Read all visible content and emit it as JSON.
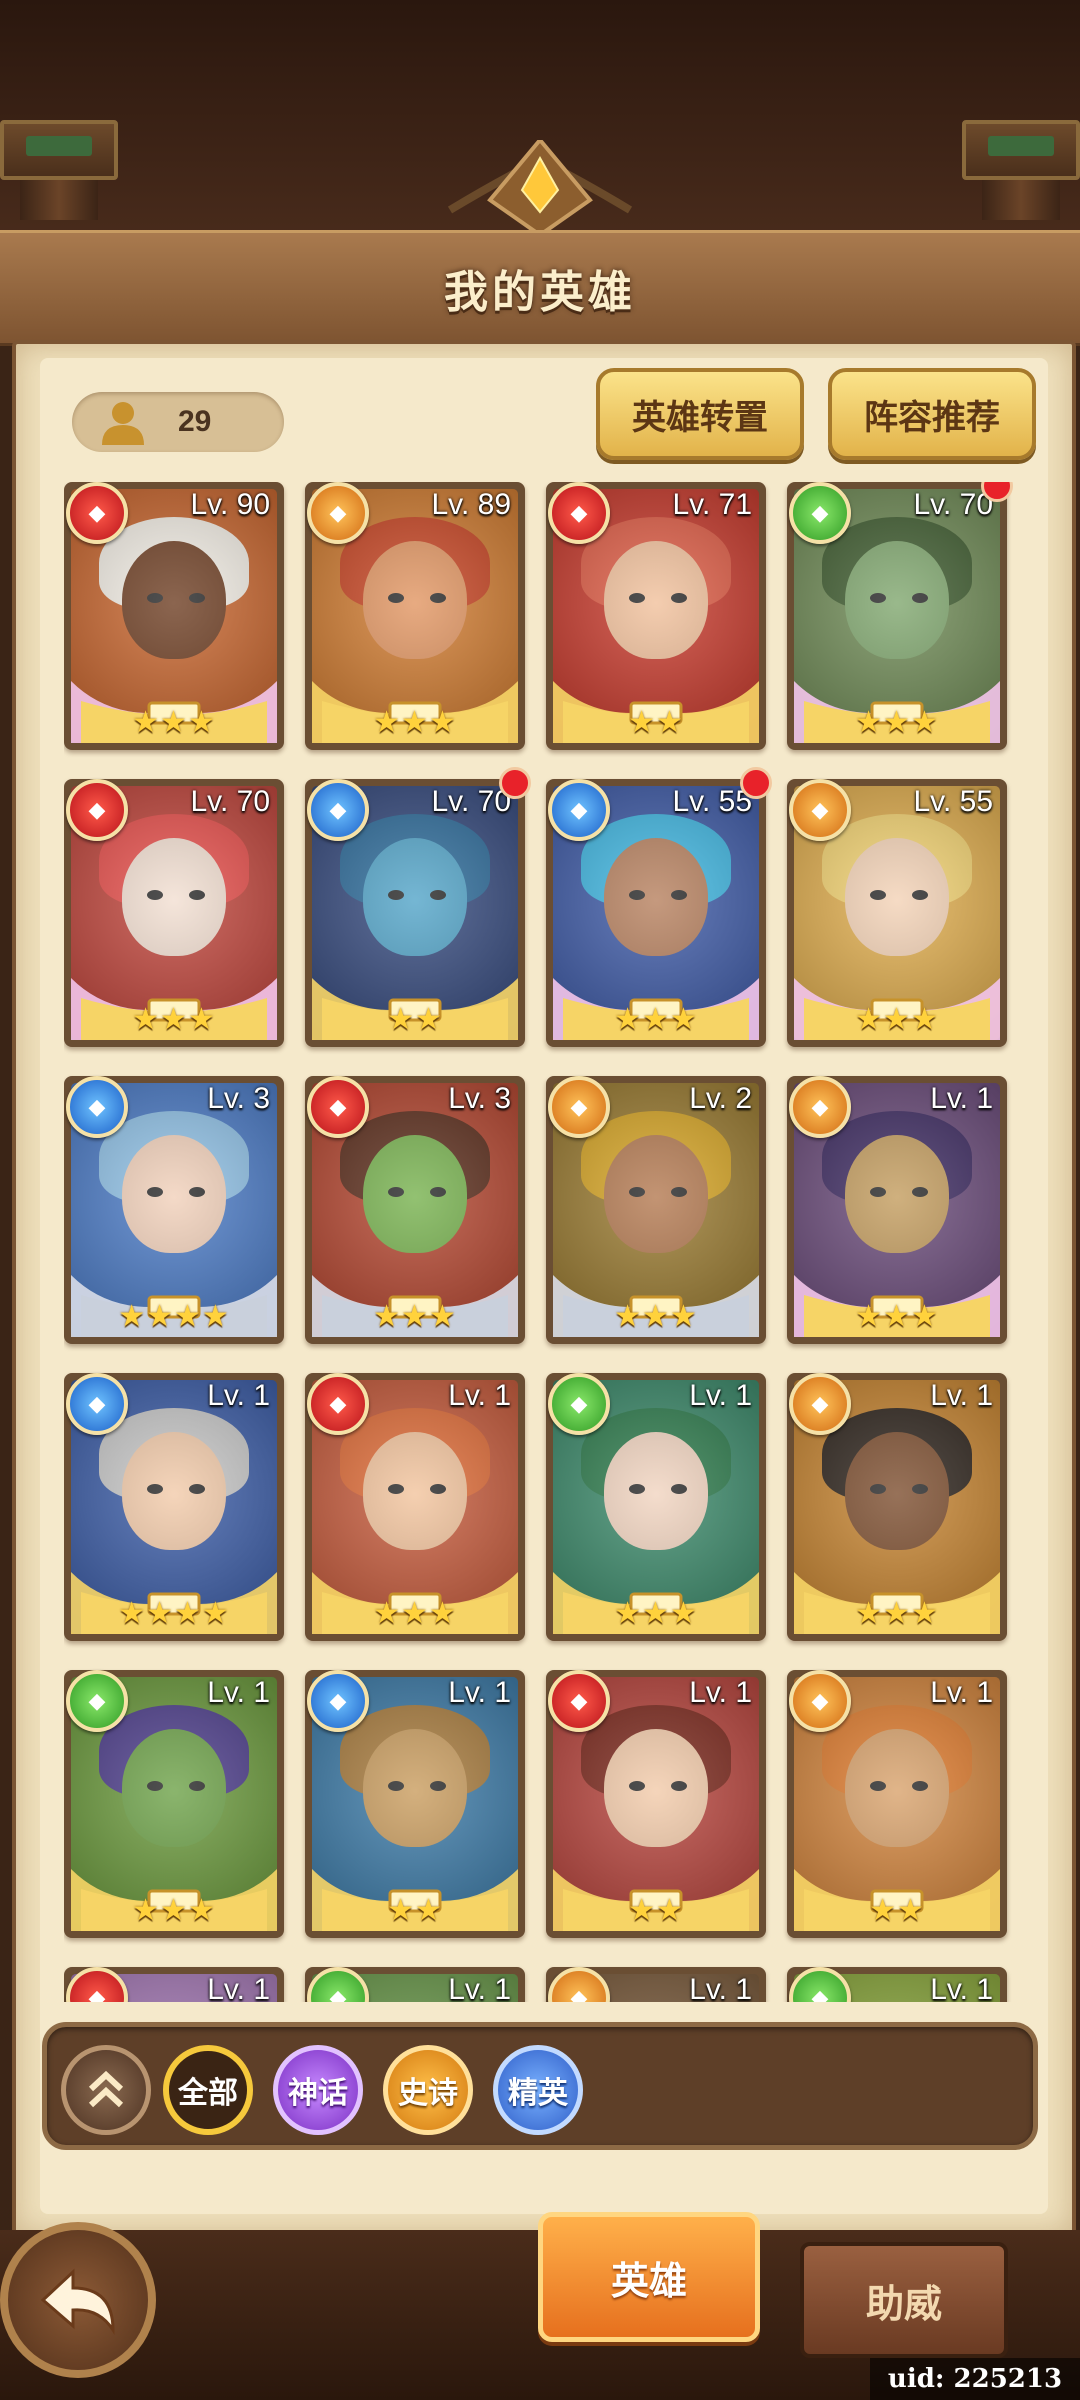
{
  "header": {
    "title": "我的英雄"
  },
  "count": {
    "value": "29"
  },
  "buttons": {
    "transfer": "英雄转置",
    "lineup": "阵容推荐"
  },
  "heroes": [
    {
      "level": "Lv. 90",
      "element": "fire",
      "stars": "★★★",
      "rarity": "mythic",
      "notify": false,
      "bg": "#c9642b",
      "skin": "#6b3a1e",
      "hair": "#f4efe6"
    },
    {
      "level": "Lv. 89",
      "element": "earth",
      "stars": "★★★",
      "rarity": "epic",
      "notify": false,
      "bg": "#d27b2e",
      "skin": "#e1935e",
      "hair": "#c8421f"
    },
    {
      "level": "Lv. 71",
      "element": "fire",
      "stars": "★★",
      "rarity": "epic",
      "notify": false,
      "bg": "#c9382a",
      "skin": "#f1bf99",
      "hair": "#e05a42"
    },
    {
      "level": "Lv. 70",
      "element": "nature",
      "stars": "★★★",
      "rarity": "mythic",
      "notify": true,
      "bg": "#6f8b55",
      "skin": "#7da56b",
      "hair": "#3c5a2c"
    },
    {
      "level": "Lv. 70",
      "element": "fire",
      "stars": "★★★",
      "rarity": "mythic",
      "notify": false,
      "bg": "#c2443a",
      "skin": "#f2ded0",
      "hair": "#e94c48"
    },
    {
      "level": "Lv. 70",
      "element": "water",
      "stars": "★★",
      "rarity": "epic",
      "notify": true,
      "bg": "#34497e",
      "skin": "#4ea2c7",
      "hair": "#2a6a9a"
    },
    {
      "level": "Lv. 55",
      "element": "water",
      "stars": "★★★",
      "rarity": "mythic",
      "notify": true,
      "bg": "#3d5aa8",
      "skin": "#b57d5a",
      "hair": "#3cb6e2"
    },
    {
      "level": "Lv. 55",
      "element": "earth",
      "stars": "★★★",
      "rarity": "mythic",
      "notify": false,
      "bg": "#e2ae4c",
      "skin": "#f3d1b4",
      "hair": "#f4d36f"
    },
    {
      "level": "Lv. 3",
      "element": "water",
      "stars": "★★★★",
      "rarity": "elite",
      "notify": false,
      "bg": "#4a7bc8",
      "skin": "#f1cfb8",
      "hair": "#8fc2e8"
    },
    {
      "level": "Lv. 3",
      "element": "fire",
      "stars": "★★★",
      "rarity": "elite",
      "notify": false,
      "bg": "#b6452e",
      "skin": "#74b04a",
      "hair": "#5a2a18"
    },
    {
      "level": "Lv. 2",
      "element": "earth",
      "stars": "★★★",
      "rarity": "elite",
      "notify": false,
      "bg": "#9a7a2e",
      "skin": "#b2764c",
      "hair": "#d7a420"
    },
    {
      "level": "Lv. 1",
      "element": "earth",
      "stars": "★★★",
      "rarity": "mythic",
      "notify": false,
      "bg": "#6a4a7a",
      "skin": "#c29a5a",
      "hair": "#3b2860"
    },
    {
      "level": "Lv. 1",
      "element": "water",
      "stars": "★★★★",
      "rarity": "epic",
      "notify": false,
      "bg": "#3a5ca8",
      "skin": "#f2c9a7",
      "hair": "#c8c8c8"
    },
    {
      "level": "Lv. 1",
      "element": "fire",
      "stars": "★★★",
      "rarity": "epic",
      "notify": false,
      "bg": "#c85a3a",
      "skin": "#f2c29a",
      "hair": "#e16a34"
    },
    {
      "level": "Lv. 1",
      "element": "nature",
      "stars": "★★★",
      "rarity": "epic",
      "notify": false,
      "bg": "#3a8a6a",
      "skin": "#f1d3be",
      "hair": "#2a7a4a"
    },
    {
      "level": "Lv. 1",
      "element": "earth",
      "stars": "★★★",
      "rarity": "epic",
      "notify": false,
      "bg": "#c8842e",
      "skin": "#7a4a2a",
      "hair": "#2a2018"
    },
    {
      "level": "Lv. 1",
      "element": "nature",
      "stars": "★★★",
      "rarity": "epic",
      "notify": false,
      "bg": "#6a9a3a",
      "skin": "#6aa044",
      "hair": "#4a3a8a"
    },
    {
      "level": "Lv. 1",
      "element": "water",
      "stars": "★★",
      "rarity": "epic",
      "notify": false,
      "bg": "#3a7aa8",
      "skin": "#c89a5a",
      "hair": "#a87a3a"
    },
    {
      "level": "Lv. 1",
      "element": "fire",
      "stars": "★★",
      "rarity": "epic",
      "notify": false,
      "bg": "#b8423a",
      "skin": "#f2c9a7",
      "hair": "#7a2418"
    },
    {
      "level": "Lv. 1",
      "element": "earth",
      "stars": "★★",
      "rarity": "epic",
      "notify": false,
      "bg": "#d4843a",
      "skin": "#d8a068",
      "hair": "#e07a2a"
    },
    {
      "level": "Lv. 1",
      "element": "fire",
      "stars": "",
      "rarity": "epic",
      "notify": false,
      "bg": "#a77ab8",
      "skin": "#e8d2f2",
      "hair": "#c8a8e0"
    },
    {
      "level": "Lv. 1",
      "element": "nature",
      "stars": "",
      "rarity": "epic",
      "notify": false,
      "bg": "#6a9a4a",
      "skin": "#e8e8e8",
      "hair": "#ffffff"
    },
    {
      "level": "Lv. 1",
      "element": "earth",
      "stars": "",
      "rarity": "epic",
      "notify": false,
      "bg": "#7a5a3a",
      "skin": "#6a4a2a",
      "hair": "#4a3020"
    },
    {
      "level": "Lv. 1",
      "element": "nature",
      "stars": "",
      "rarity": "epic",
      "notify": false,
      "bg": "#8aa83a",
      "skin": "#f2a83a",
      "hair": "#e07a1a"
    }
  ],
  "filters": {
    "all": "全部",
    "mythic": "神话",
    "epic": "史诗",
    "elite": "精英"
  },
  "tabs": {
    "hero": "英雄",
    "support": "助威"
  },
  "uid": "uid: 225213"
}
